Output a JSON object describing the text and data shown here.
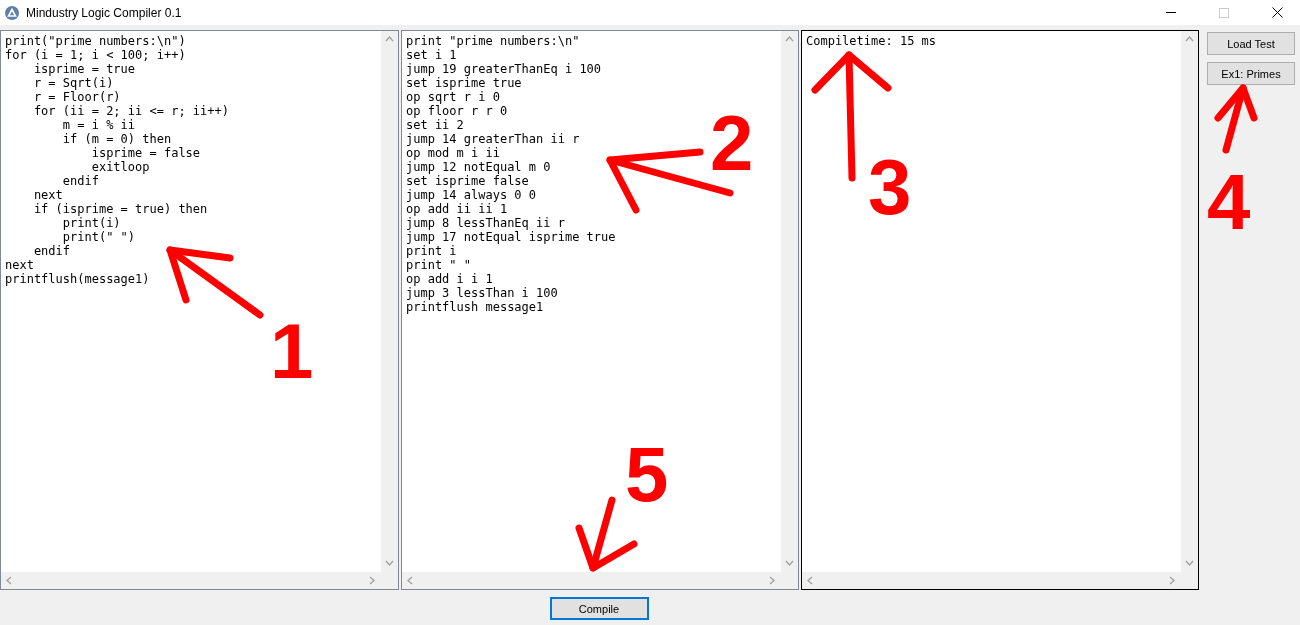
{
  "window": {
    "title": "Mindustry Logic Compiler 0.1"
  },
  "panels": [
    {
      "focused": false,
      "lines": [
        "print(\"prime numbers:\\n\")",
        "for (i = 1; i < 100; i++)",
        "    isprime = true",
        "    r = Sqrt(i)",
        "    r = Floor(r)",
        "    for (ii = 2; ii <= r; ii++)",
        "        m = i % ii",
        "        if (m = 0) then",
        "            isprime = false",
        "            exitloop",
        "        endif",
        "    next",
        "    if (isprime = true) then",
        "        print(i)",
        "        print(\" \")",
        "    endif",
        "next",
        "printflush(message1)"
      ]
    },
    {
      "focused": false,
      "lines": [
        "print \"prime numbers:\\n\"",
        "set i 1",
        "jump 19 greaterThanEq i 100",
        "set isprime true",
        "op sqrt r i 0",
        "op floor r r 0",
        "set ii 2",
        "jump 14 greaterThan ii r",
        "op mod m i ii",
        "jump 12 notEqual m 0",
        "set isprime false",
        "jump 14 always 0 0",
        "op add ii ii 1",
        "jump 8 lessThanEq ii r",
        "jump 17 notEqual isprime true",
        "print i",
        "print \" \"",
        "op add i i 1",
        "jump 3 lessThan i 100",
        "printflush message1"
      ]
    },
    {
      "focused": true,
      "lines": [
        "Compiletime: 15 ms"
      ]
    }
  ],
  "side_buttons": [
    {
      "label": "Load Test"
    },
    {
      "label": "Ex1: Primes"
    }
  ],
  "compile_button": {
    "label": "Compile",
    "focused": true
  },
  "annotations": [
    {
      "label": "1"
    },
    {
      "label": "2"
    },
    {
      "label": "3"
    },
    {
      "label": "4"
    },
    {
      "label": "5"
    }
  ]
}
